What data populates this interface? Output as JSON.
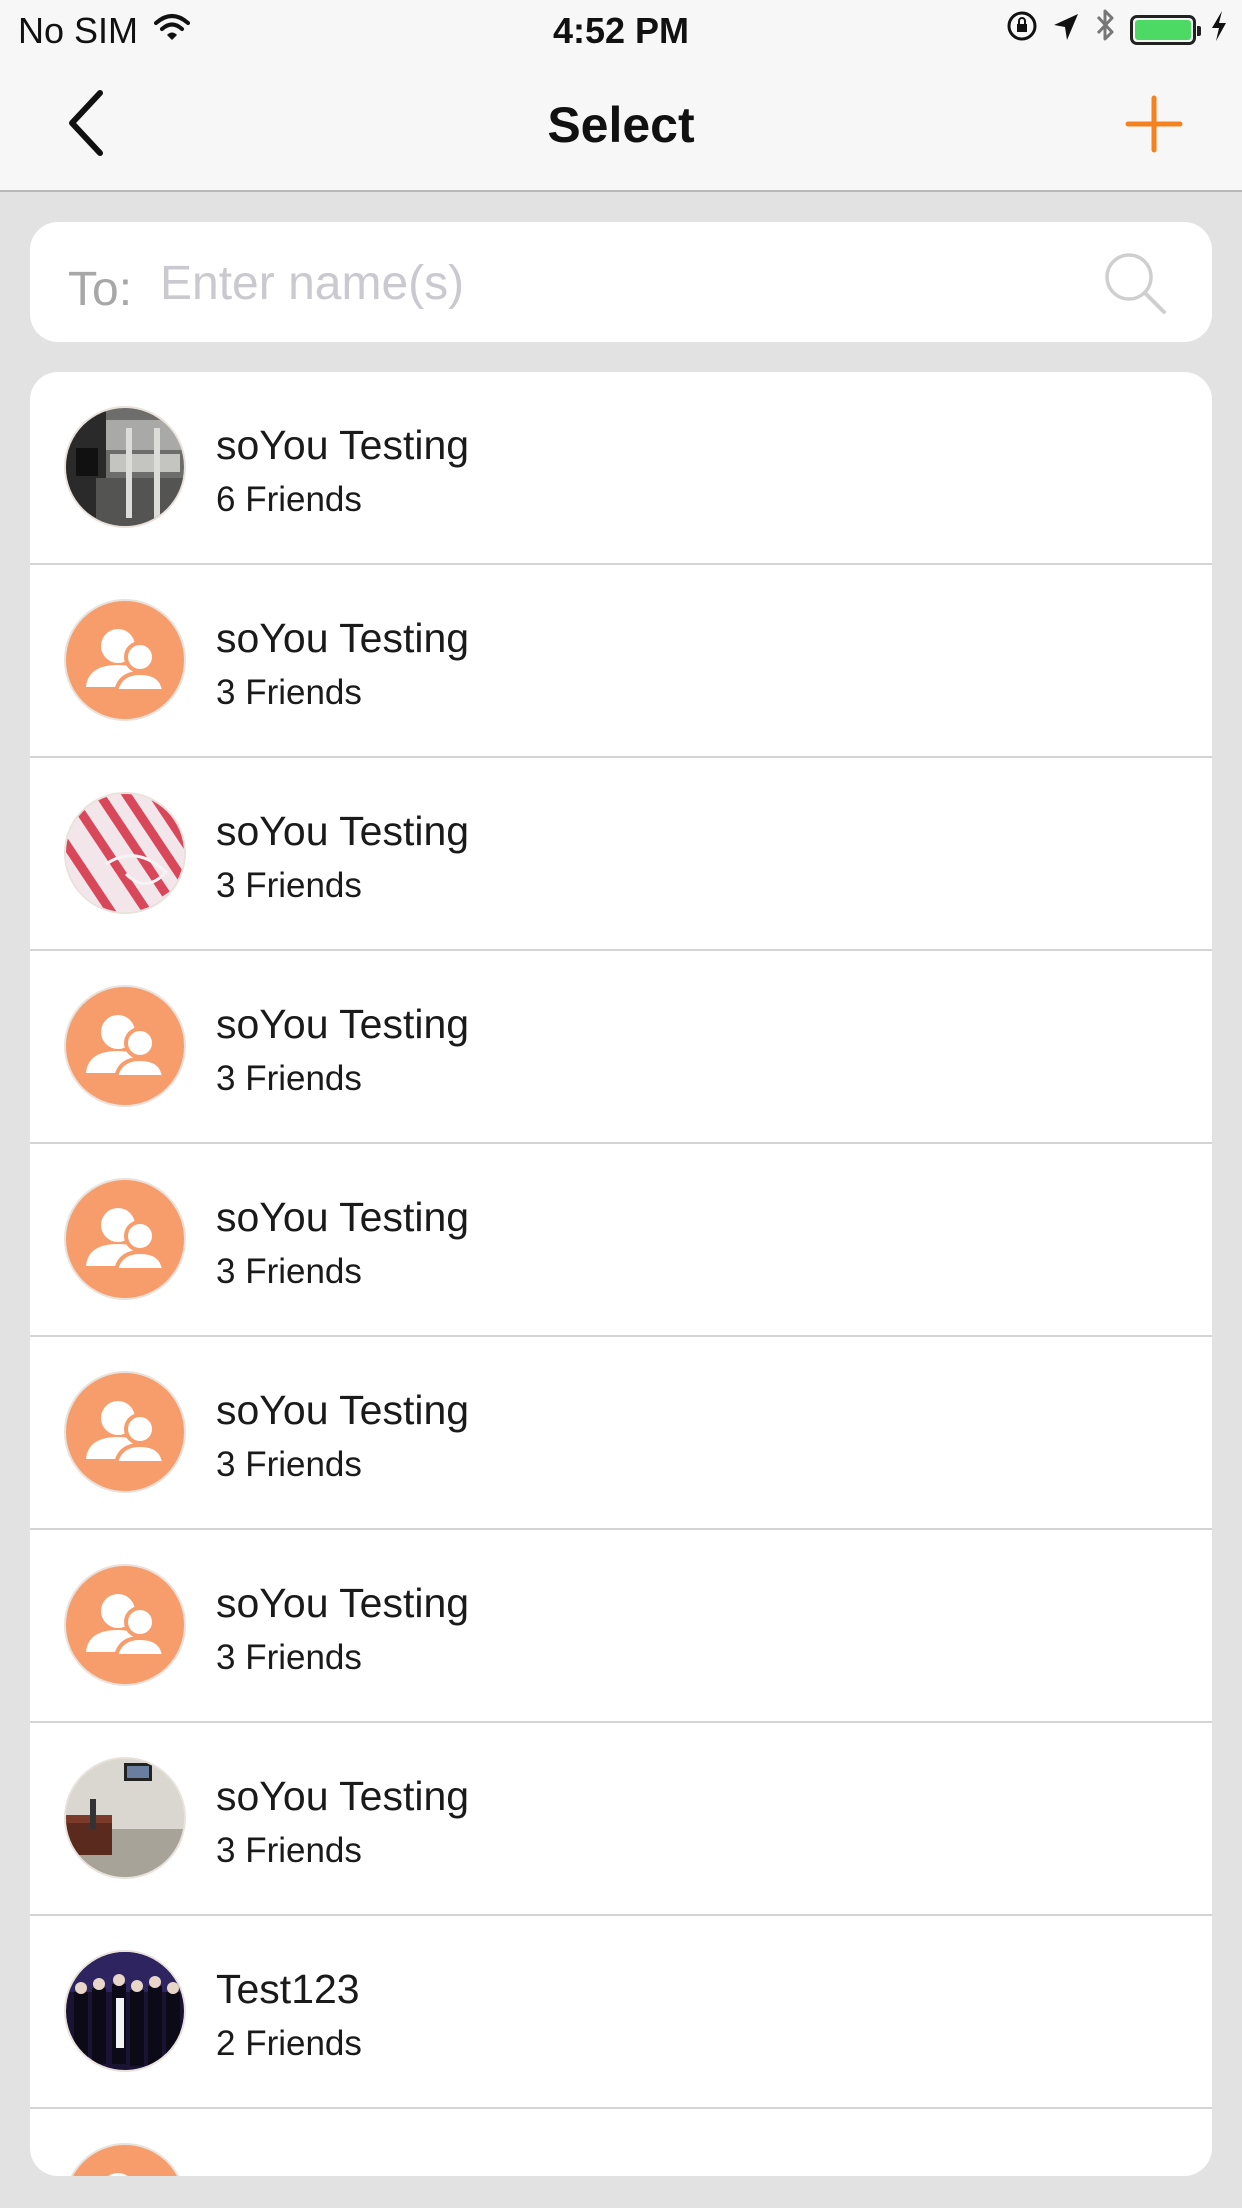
{
  "status_bar": {
    "carrier": "No SIM",
    "time": "4:52 PM",
    "battery_color": "#4cd964"
  },
  "nav": {
    "title": "Select",
    "back_icon": "chevron-left-icon",
    "add_icon": "plus-icon",
    "accent_color": "#f5821f"
  },
  "search": {
    "prefix": "To:",
    "placeholder": "Enter name(s)",
    "value": ""
  },
  "groups": [
    {
      "name": "soYou Testing",
      "subtitle": "6 Friends",
      "avatar": "photo-machinery"
    },
    {
      "name": "soYou Testing",
      "subtitle": "3 Friends",
      "avatar": "group-icon"
    },
    {
      "name": "soYou Testing",
      "subtitle": "3 Friends",
      "avatar": "photo-striped-fabric"
    },
    {
      "name": "soYou Testing",
      "subtitle": "3 Friends",
      "avatar": "group-icon"
    },
    {
      "name": "soYou Testing",
      "subtitle": "3 Friends",
      "avatar": "group-icon"
    },
    {
      "name": "soYou Testing",
      "subtitle": "3 Friends",
      "avatar": "group-icon"
    },
    {
      "name": "soYou Testing",
      "subtitle": "3 Friends",
      "avatar": "group-icon"
    },
    {
      "name": "soYou Testing",
      "subtitle": "3 Friends",
      "avatar": "photo-room"
    },
    {
      "name": "Test123",
      "subtitle": "2 Friends",
      "avatar": "photo-crowd"
    },
    {
      "name": "",
      "subtitle": "",
      "avatar": "group-icon"
    }
  ]
}
